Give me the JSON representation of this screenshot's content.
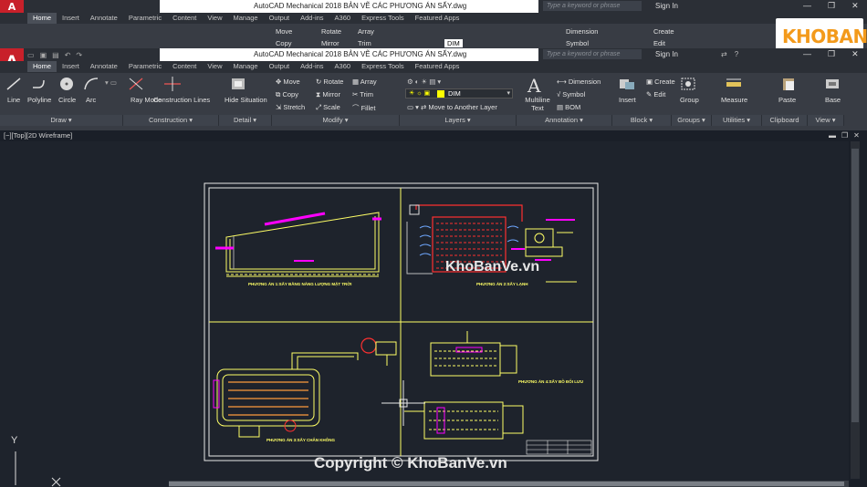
{
  "app": {
    "logo": "A",
    "title": "AutoCAD Mechanical 2018   BẢN VẼ CÁC PHƯƠNG ÁN SẤY.dwg",
    "search_placeholder": "Type a keyword or phrase",
    "signin": "Sign In"
  },
  "tabs": [
    "Home",
    "Insert",
    "Annotate",
    "Parametric",
    "Content",
    "View",
    "Manage",
    "Output",
    "Add-ins",
    "A360",
    "Express Tools",
    "Featured Apps"
  ],
  "ribbon": {
    "draw": {
      "label": "Draw",
      "line": "Line",
      "polyline": "Polyline",
      "circle": "Circle",
      "arc": "Arc"
    },
    "construction": {
      "label": "Construction",
      "ray_mode": "Ray Mode",
      "construction_lines": "Construction Lines"
    },
    "detail": {
      "label": "Detail",
      "hide_situation": "Hide Situation"
    },
    "modify": {
      "label": "Modify",
      "move": "Move",
      "rotate": "Rotate",
      "array": "Array",
      "copy": "Copy",
      "mirror": "Mirror",
      "trim": "Trim",
      "stretch": "Stretch",
      "scale": "Scale",
      "fillet": "Fillet"
    },
    "layers": {
      "label": "Layers",
      "current_layer": "DIM",
      "move_to_layer": "Move to Another Layer"
    },
    "annotation": {
      "label": "Annotation",
      "multiline_text": "Multiline Text",
      "dimension": "Dimension",
      "symbol": "Symbol",
      "bom": "BOM"
    },
    "block": {
      "label": "Block",
      "insert": "Insert",
      "create": "Create",
      "edit": "Edit"
    },
    "groups": {
      "label": "Groups",
      "group": "Group"
    },
    "utilities": {
      "label": "Utilities",
      "measure": "Measure"
    },
    "clipboard": {
      "label": "Clipboard",
      "paste": "Paste"
    },
    "view": {
      "label": "View",
      "base": "Base"
    }
  },
  "viewport": {
    "label": "[−][Top][2D Wireframe]",
    "axis_y": "Y"
  },
  "drawing": {
    "caption_1": "PHƯƠNG ÁN 1:SẤY BẰNG NĂNG LƯỢNG MẶT TRỜI",
    "caption_2": "PHƯƠNG ÁN 2:SẤY LẠNH",
    "caption_3": "PHƯƠNG ÁN 3:SẤY CHÂN KHÔNG",
    "caption_4": "PHƯƠNG ÁN 4:SẤY BỒ ĐỐI LƯU"
  },
  "watermark": {
    "center": "KhoBanVe.vn",
    "copyright": "Copyright © KhoBanVe.vn",
    "logo": "KHOBANVE"
  },
  "colors": {
    "accent_red": "#c8202a",
    "cad_yellow": "#ffff66",
    "cad_magenta": "#ff00ff",
    "cad_red": "#ff3030",
    "logo_orange": "#f39a1b"
  }
}
